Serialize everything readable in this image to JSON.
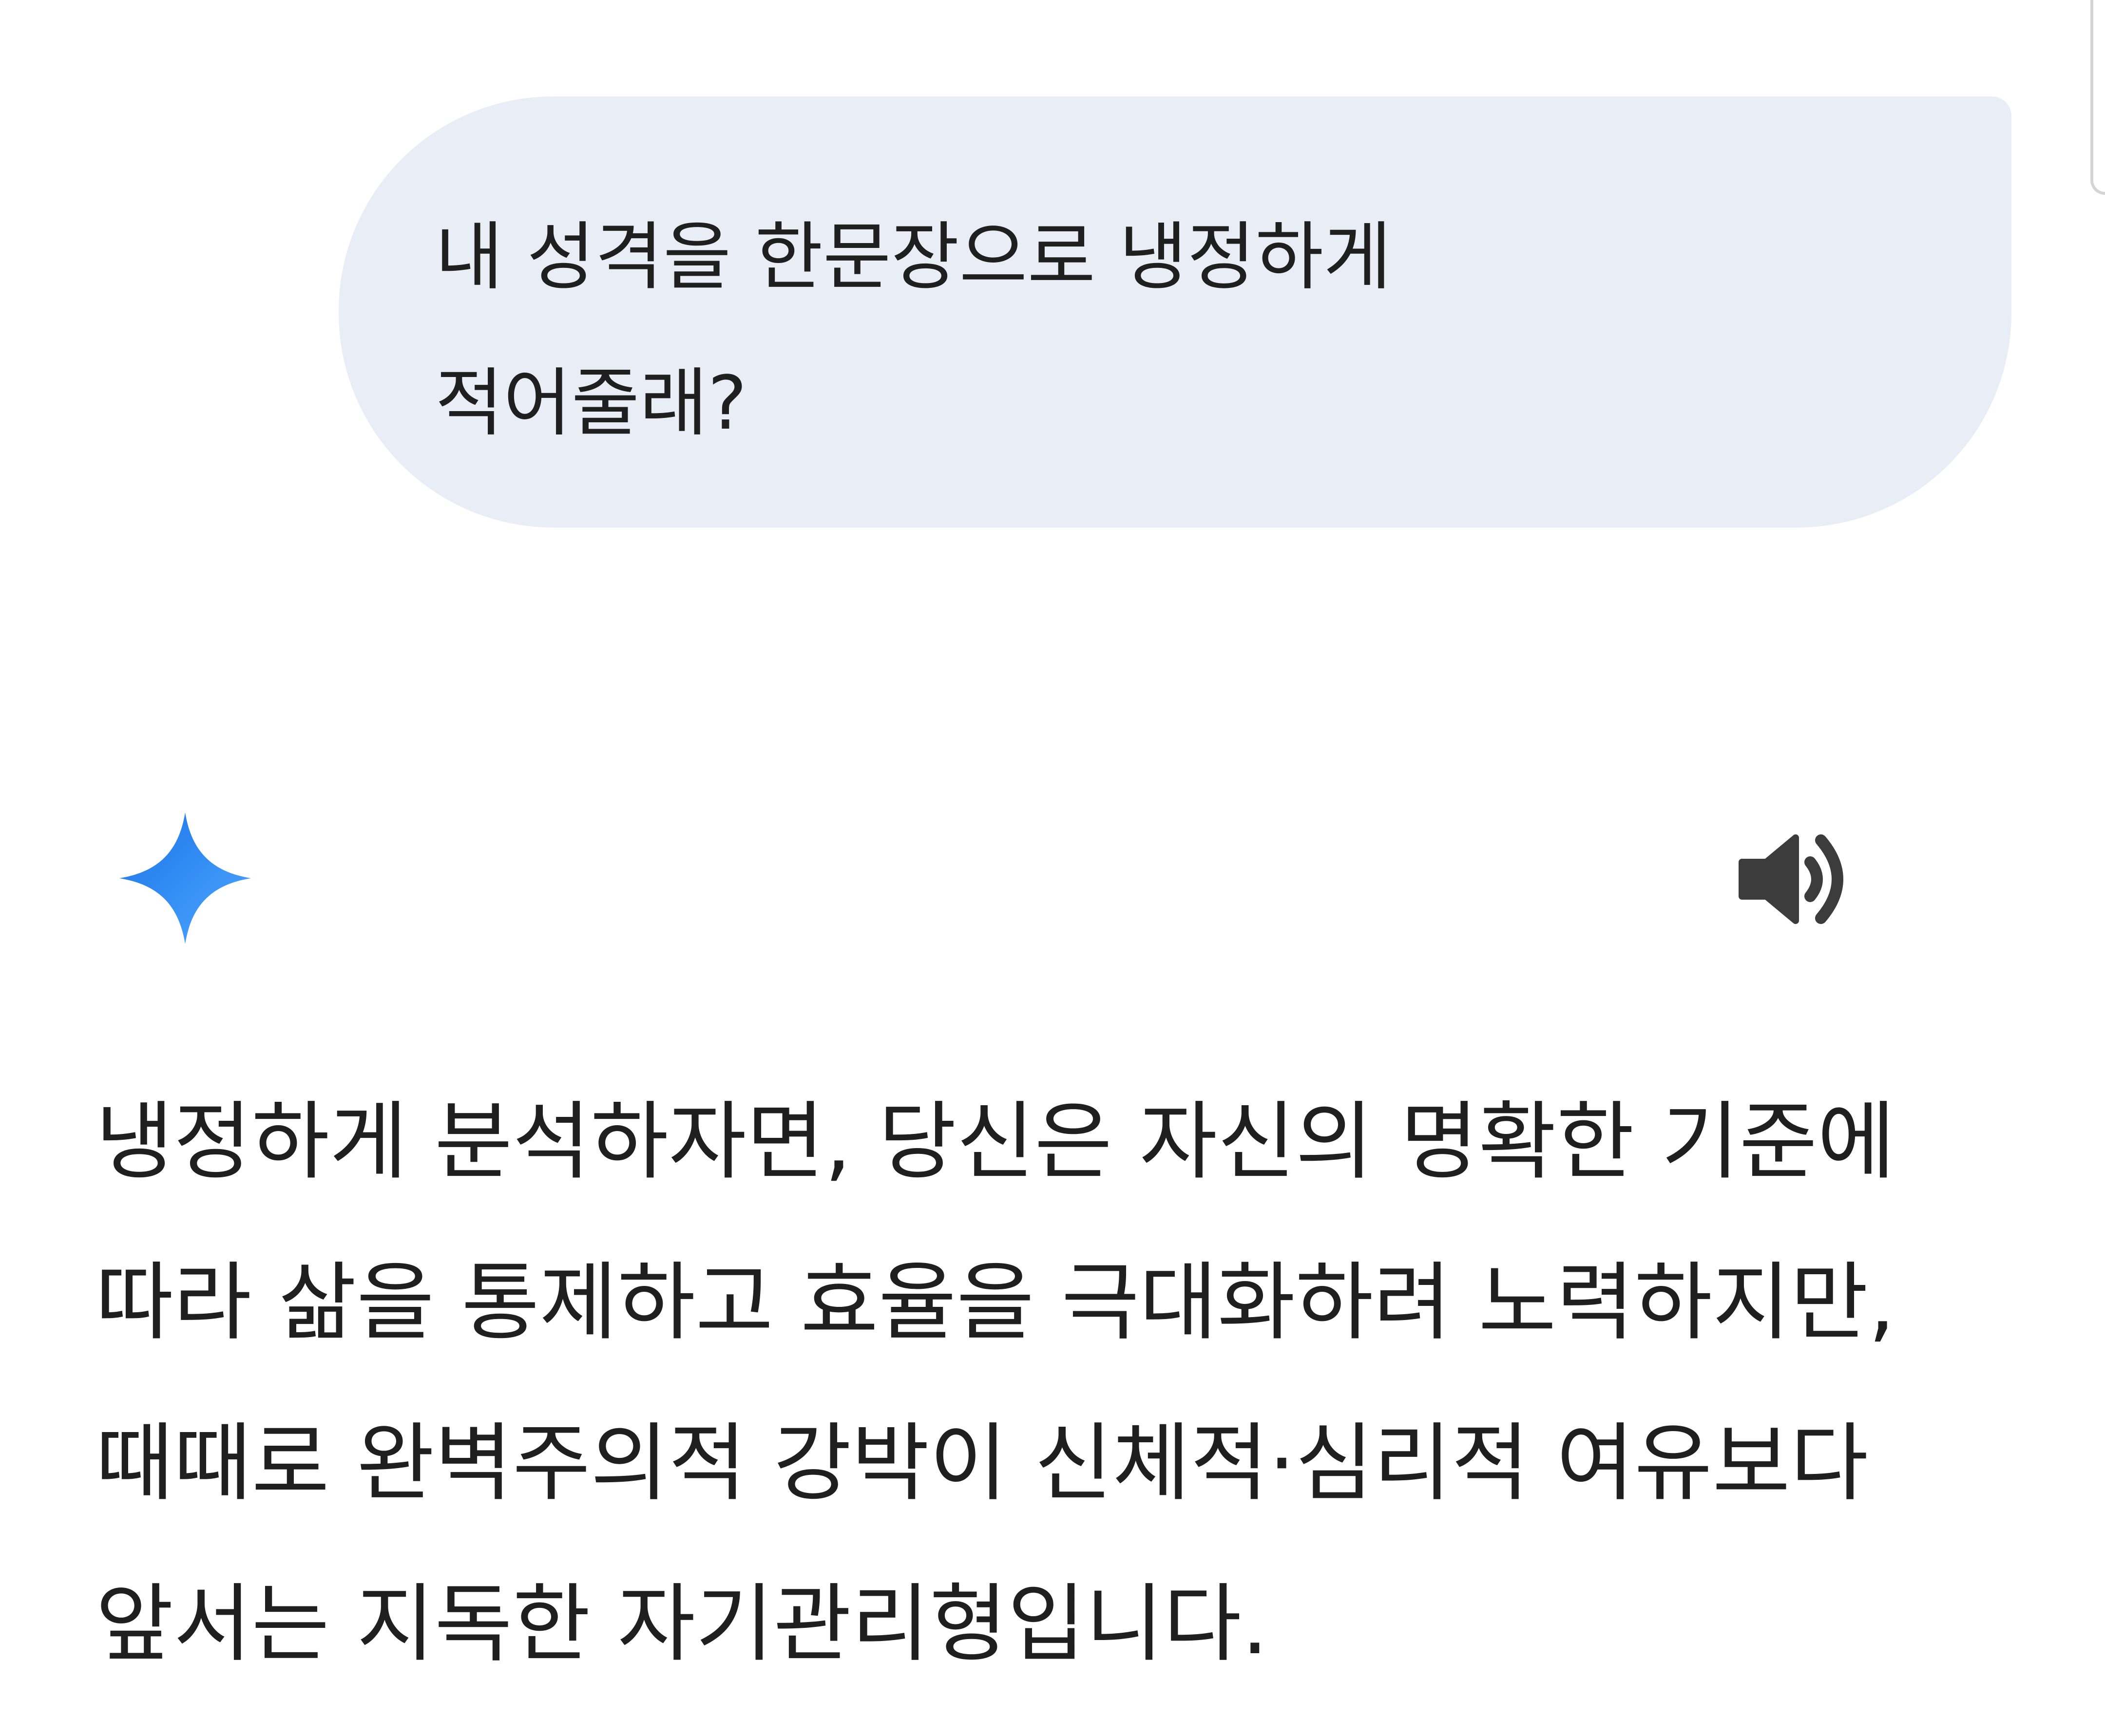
{
  "conversation": {
    "user_message": {
      "line1": "내 성격을 한문장으로 냉정하게",
      "line2": "적어줄래?"
    },
    "assistant": {
      "avatar_icon": "gemini-sparkle-icon",
      "avatar_color_start": "#1a73e8",
      "avatar_color_end": "#4fa8ff",
      "read_aloud_icon": "speaker-icon",
      "response_lines": [
        "냉정하게 분석하자면, 당신은 자신의 명확한 기준에",
        "따라 삶을 통제하고 효율을 극대화하려 노력하지만,",
        "때때로 완벽주의적 강박이 신체적·심리적 여유보다",
        "앞서는 지독한 자기관리형입니다."
      ]
    }
  },
  "colors": {
    "user_bubble_bg": "#e9eef6",
    "text": "#1f1f1f",
    "icon_dark": "#3c3c3c"
  }
}
